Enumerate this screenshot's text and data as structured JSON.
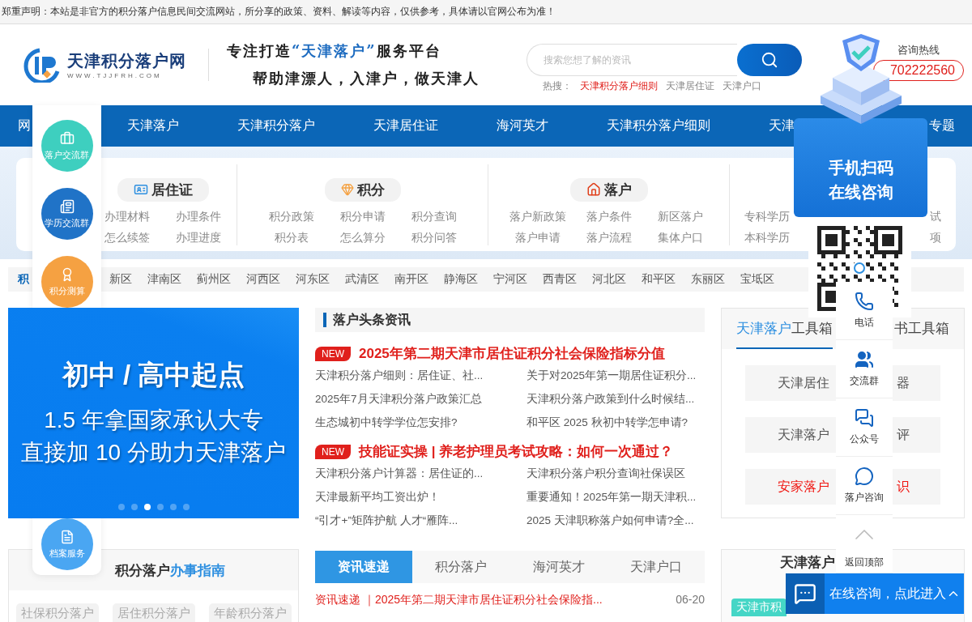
{
  "notice": "郑重声明：本站是非官方的积分落户信息民间交流网站，所分享的政策、资料、解读等内容，仅供参考，具体请以官网公布为准！",
  "header": {
    "logo_title": "天津积分落户网",
    "logo_url": "WWW.TJJFRH.COM",
    "slogan_before": "专注打造",
    "slogan_quote": "“天津落户”",
    "slogan_after": "服务平台",
    "slogan_line2": "帮助津漂人，入津户，做天津人",
    "search": {
      "placeholder": "搜索您想了解的资讯"
    },
    "hot_label": "热搜：",
    "hot_links": [
      {
        "text": "天津积分落户细则",
        "highlighted": true
      },
      {
        "text": "天津居住证",
        "highlighted": false
      },
      {
        "text": "天津户口",
        "highlighted": false
      }
    ],
    "hotline_label": "咨询热线",
    "hotline_number": "702222560"
  },
  "nav": [
    {
      "label": "网"
    },
    {
      "label": "天津落户"
    },
    {
      "label": "天津积分落户"
    },
    {
      "label": "天津居住证"
    },
    {
      "label": "海河英才"
    },
    {
      "label": "天津积分落户细则"
    },
    {
      "label": "天津"
    },
    {
      "label": "专题"
    }
  ],
  "categories": [
    {
      "kind": "residence",
      "title": "居住证",
      "rows": [
        [
          "办理材料",
          "办理条件"
        ],
        [
          "怎么续签",
          "办理进度"
        ]
      ]
    },
    {
      "kind": "points",
      "title": "积分",
      "rows": [
        [
          "积分政策",
          "积分申请",
          "积分查询"
        ],
        [
          "积分表",
          "怎么算分",
          "积分问答"
        ]
      ]
    },
    {
      "kind": "settle",
      "title": "落户",
      "rows": [
        [
          "落户新政策",
          "落户条件",
          "新区落户"
        ],
        [
          "落户申请",
          "落户流程",
          "集体户口"
        ]
      ]
    },
    {
      "kind": "education",
      "rows": [
        [
          "专科学历",
          "试"
        ],
        [
          "本科学历",
          "项"
        ]
      ]
    }
  ],
  "districts": [
    {
      "kind": "label",
      "text": "积"
    },
    {
      "kind": "link",
      "text": "新区"
    },
    {
      "kind": "link",
      "text": "津南区"
    },
    {
      "kind": "link",
      "text": "蓟州区"
    },
    {
      "kind": "link",
      "text": "河西区"
    },
    {
      "kind": "link",
      "text": "河东区"
    },
    {
      "kind": "link",
      "text": "武清区"
    },
    {
      "kind": "link",
      "text": "南开区"
    },
    {
      "kind": "link",
      "text": "静海区"
    },
    {
      "kind": "link",
      "text": "宁河区"
    },
    {
      "kind": "link",
      "text": "西青区"
    },
    {
      "kind": "link",
      "text": "河北区"
    },
    {
      "kind": "link",
      "text": "和平区"
    },
    {
      "kind": "link",
      "text": "东丽区"
    },
    {
      "kind": "link",
      "text": "宝坻区"
    }
  ],
  "banner": {
    "lines": [
      "初中 / 高中起点",
      "1.5 年拿国家承认大专",
      "直接加 10 分助力天津落户"
    ],
    "dots": [
      {
        "selected": false
      },
      {
        "selected": false
      },
      {
        "selected": true
      },
      {
        "selected": false
      },
      {
        "selected": false
      },
      {
        "selected": false
      }
    ]
  },
  "guide": {
    "title": "积分落户",
    "title_highlight": "办事指南",
    "buttons": [
      "社保积分落户",
      "居住积分落户",
      "年龄积分落户"
    ]
  },
  "headline_news": {
    "title": "落户头条资讯",
    "blocks": [
      {
        "badge": "NEW",
        "headline": "2025年第二期天津市居住证积分社会保险指标分值",
        "items": [
          "天津积分落户细则：居住证、社...",
          "关于对2025年第一期居住证积分...",
          "2025年7月天津积分落户政策汇总",
          "天津积分落户政策到什么时候结...",
          "生态城初中转学学位怎安排?",
          "和平区 2025 秋初中转学怎申请?"
        ]
      },
      {
        "badge": "NEW",
        "headline": "技能证实操 | 养老护理员考试攻略：如何一次通过？",
        "items": [
          "天津积分落户计算器：居住证的...",
          "天津积分落户积分查询社保误区",
          "天津最新平均工资出炉！",
          "重要通知！2025年第一期天津积...",
          "“引才+”矩阵护航 人才“雁阵...",
          "2025 天津职称落户如何申请?全..."
        ]
      }
    ]
  },
  "news_tabs": [
    {
      "label": "资讯速递",
      "selected": true
    },
    {
      "label": "积分落户",
      "selected": false
    },
    {
      "label": "海河英才",
      "selected": false
    },
    {
      "label": "天津户口",
      "selected": false
    }
  ],
  "news_list": [
    {
      "text": "资讯速递 ｜2025年第二期天津市居住证积分社会保险指...",
      "date": "06-20",
      "highlighted": true
    }
  ],
  "toolbox": {
    "tabs": [
      {
        "highlight": "天津落户",
        "label": "工具箱",
        "selected": true
      },
      {
        "label": "书工具箱",
        "selected": false
      }
    ],
    "tools": [
      {
        "left": "天津居住",
        "right": "器",
        "highlighted": false
      },
      {
        "left": "天津落户",
        "right": "评",
        "highlighted": false
      },
      {
        "left": "安家落户",
        "right": "识",
        "highlighted": true
      }
    ]
  },
  "ways": {
    "title": "天津落户",
    "tag": "天津市积"
  },
  "float_menu": [
    {
      "kind": "group",
      "label": "落户交流群",
      "color": "#3ecfbf"
    },
    {
      "kind": "education",
      "label": "学历交流群",
      "color": "#2073c7"
    },
    {
      "kind": "calc",
      "label": "积分测算",
      "color": "#f5a142"
    },
    {
      "kind": "archive",
      "label": "档案服务",
      "color": "#4aa6f2"
    }
  ],
  "qr_panel": {
    "lines": [
      "手机扫码",
      "在线咨询"
    ]
  },
  "side_tools": [
    {
      "kind": "phone",
      "label": "电话"
    },
    {
      "kind": "group",
      "label": "交流群"
    },
    {
      "kind": "wechat",
      "label": "公众号"
    },
    {
      "kind": "consult",
      "label": "落户咨询"
    },
    {
      "kind": "top",
      "label": "返回顶部"
    }
  ],
  "chat_bar": {
    "label": "在线咨询，点此进入"
  }
}
